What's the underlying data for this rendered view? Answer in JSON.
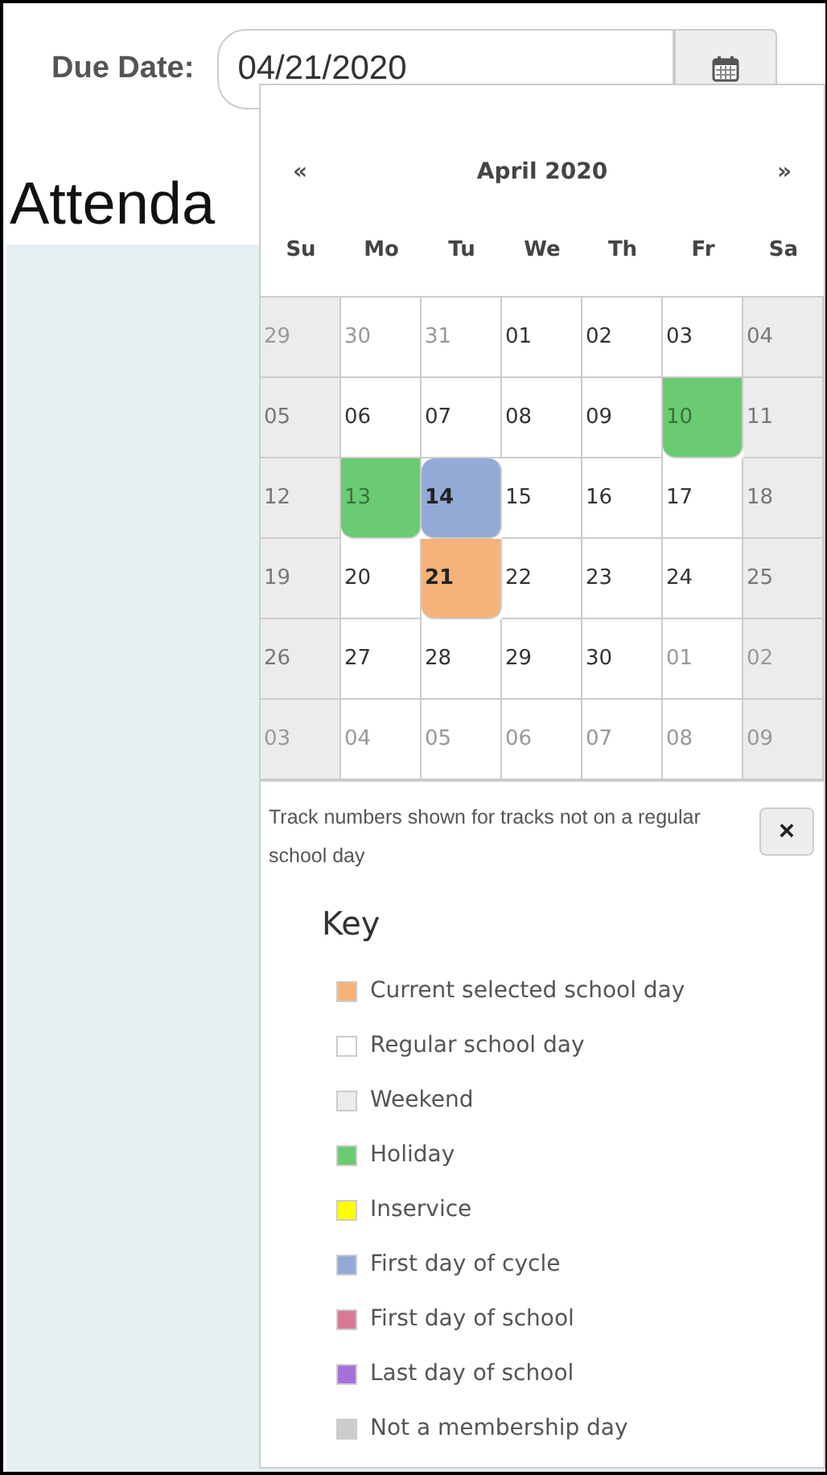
{
  "due_date": {
    "label": "Due Date:",
    "value": "04/21/2020"
  },
  "page_title": "Attenda",
  "calendar": {
    "prev": "«",
    "month": "April 2020",
    "next": "»",
    "weekdays": [
      "Su",
      "Mo",
      "Tu",
      "We",
      "Th",
      "Fr",
      "Sa"
    ],
    "weeks": [
      [
        {
          "day": "29",
          "kind": "weekend",
          "other_month": true
        },
        {
          "day": "30",
          "kind": "regular",
          "other_month": true
        },
        {
          "day": "31",
          "kind": "regular",
          "other_month": true
        },
        {
          "day": "01",
          "kind": "regular",
          "other_month": false
        },
        {
          "day": "02",
          "kind": "regular",
          "other_month": false
        },
        {
          "day": "03",
          "kind": "regular",
          "other_month": false
        },
        {
          "day": "04",
          "kind": "weekend",
          "other_month": false
        }
      ],
      [
        {
          "day": "05",
          "kind": "weekend",
          "other_month": false
        },
        {
          "day": "06",
          "kind": "regular",
          "other_month": false
        },
        {
          "day": "07",
          "kind": "regular",
          "other_month": false
        },
        {
          "day": "08",
          "kind": "regular",
          "other_month": false
        },
        {
          "day": "09",
          "kind": "regular",
          "other_month": false
        },
        {
          "day": "10",
          "kind": "holiday",
          "other_month": false
        },
        {
          "day": "11",
          "kind": "weekend",
          "other_month": false
        }
      ],
      [
        {
          "day": "12",
          "kind": "weekend",
          "other_month": false
        },
        {
          "day": "13",
          "kind": "holiday",
          "other_month": false
        },
        {
          "day": "14",
          "kind": "cycle",
          "other_month": false
        },
        {
          "day": "15",
          "kind": "regular",
          "other_month": false
        },
        {
          "day": "16",
          "kind": "regular",
          "other_month": false
        },
        {
          "day": "17",
          "kind": "regular",
          "other_month": false
        },
        {
          "day": "18",
          "kind": "weekend",
          "other_month": false
        }
      ],
      [
        {
          "day": "19",
          "kind": "weekend",
          "other_month": false
        },
        {
          "day": "20",
          "kind": "regular",
          "other_month": false
        },
        {
          "day": "21",
          "kind": "selected",
          "other_month": false
        },
        {
          "day": "22",
          "kind": "regular",
          "other_month": false
        },
        {
          "day": "23",
          "kind": "regular",
          "other_month": false
        },
        {
          "day": "24",
          "kind": "regular",
          "other_month": false
        },
        {
          "day": "25",
          "kind": "weekend",
          "other_month": false
        }
      ],
      [
        {
          "day": "26",
          "kind": "weekend",
          "other_month": false
        },
        {
          "day": "27",
          "kind": "regular",
          "other_month": false
        },
        {
          "day": "28",
          "kind": "regular",
          "other_month": false
        },
        {
          "day": "29",
          "kind": "regular",
          "other_month": false
        },
        {
          "day": "30",
          "kind": "regular",
          "other_month": false
        },
        {
          "day": "01",
          "kind": "regular",
          "other_month": true
        },
        {
          "day": "02",
          "kind": "weekend",
          "other_month": true
        }
      ],
      [
        {
          "day": "03",
          "kind": "weekend",
          "other_month": true
        },
        {
          "day": "04",
          "kind": "regular",
          "other_month": true
        },
        {
          "day": "05",
          "kind": "regular",
          "other_month": true
        },
        {
          "day": "06",
          "kind": "regular",
          "other_month": true
        },
        {
          "day": "07",
          "kind": "regular",
          "other_month": true
        },
        {
          "day": "08",
          "kind": "regular",
          "other_month": true
        },
        {
          "day": "09",
          "kind": "weekend",
          "other_month": true
        }
      ]
    ],
    "note": "Track numbers shown for tracks not on a regular school day",
    "close": "×",
    "key_title": "Key",
    "key": [
      {
        "label": "Current selected school day",
        "color": "#f5b27a"
      },
      {
        "label": "Regular school day",
        "color": "#ffffff"
      },
      {
        "label": "Weekend",
        "color": "#ececec"
      },
      {
        "label": "Holiday",
        "color": "#6acb72"
      },
      {
        "label": "Inservice",
        "color": "#ffff00"
      },
      {
        "label": "First day of cycle",
        "color": "#93aad6"
      },
      {
        "label": "First day of school",
        "color": "#d97a94"
      },
      {
        "label": "Last day of school",
        "color": "#a571d6"
      },
      {
        "label": "Not a membership day",
        "color": "#cccccc"
      }
    ]
  }
}
